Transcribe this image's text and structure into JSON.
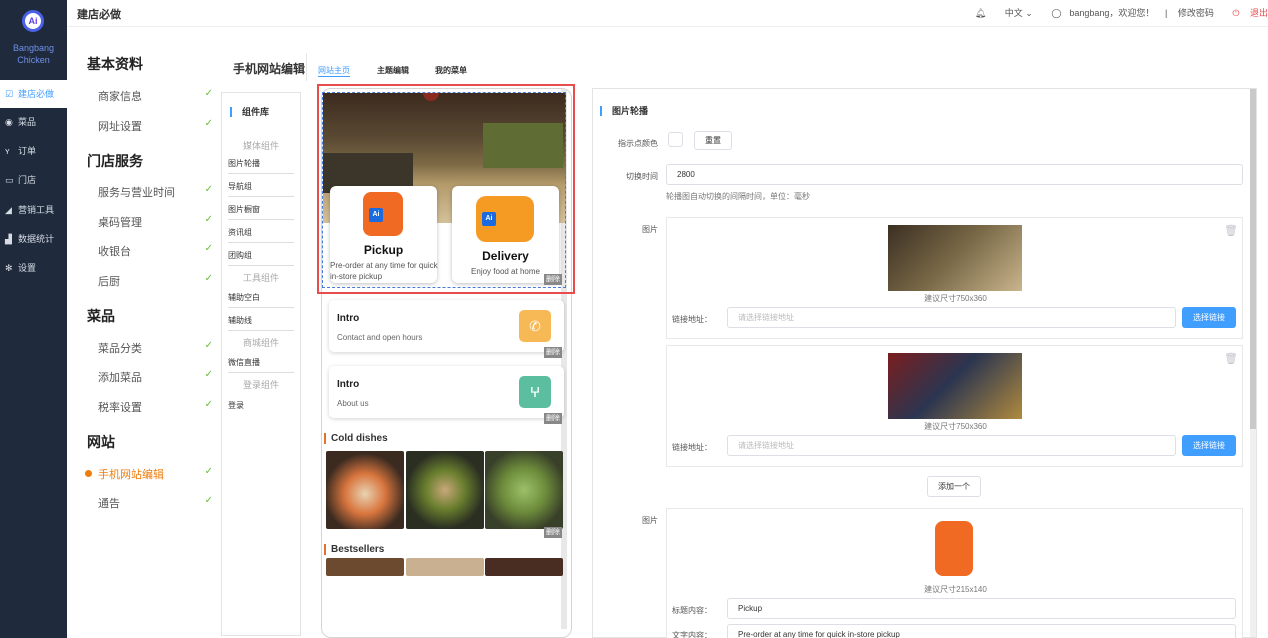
{
  "app": {
    "logo_text": "Ai",
    "brand_line1": "Bangbang",
    "brand_line2": "Chicken",
    "breadcrumb": "建店必做"
  },
  "left_nav": [
    {
      "label": "建店必做",
      "icon": "check-square-icon",
      "glyph": "☑",
      "active": true
    },
    {
      "label": "菜品",
      "icon": "dish-icon",
      "glyph": "◉",
      "active": false
    },
    {
      "label": "订单",
      "icon": "cutlery-icon",
      "glyph": "ʏ",
      "active": false
    },
    {
      "label": "门店",
      "icon": "store-icon",
      "glyph": "▭",
      "active": false
    },
    {
      "label": "营销工具",
      "icon": "megaphone-icon",
      "glyph": "◢",
      "active": false
    },
    {
      "label": "数据统计",
      "icon": "chart-icon",
      "glyph": "▟",
      "active": false
    },
    {
      "label": "设置",
      "icon": "gear-icon",
      "glyph": "✻",
      "active": false
    }
  ],
  "topbar": {
    "language": "中文",
    "user_greeting": "bangbang，欢迎您！",
    "change_password": "修改密码",
    "logout": "退出"
  },
  "secondary_menu": {
    "groups": [
      {
        "title": "基本资料",
        "items": [
          "商家信息",
          "网址设置"
        ]
      },
      {
        "title": "门店服务",
        "items": [
          "服务与营业时间",
          "桌码管理",
          "收银台",
          "后厨"
        ]
      },
      {
        "title": "菜品",
        "items": [
          "菜品分类",
          "添加菜品",
          "税率设置"
        ]
      },
      {
        "title": "网站",
        "items": [
          "手机网站编辑",
          "通告"
        ]
      }
    ],
    "active_item": "手机网站编辑",
    "check_mark": "✓"
  },
  "editor": {
    "title": "手机网站编辑",
    "tabs": [
      {
        "label": "网站主页",
        "active": true
      },
      {
        "label": "主题编辑",
        "active": false
      },
      {
        "label": "我的菜单",
        "active": false
      }
    ]
  },
  "component_library": {
    "title": "组件库",
    "groups": [
      {
        "title": "媒体组件",
        "items": [
          "图片轮播",
          "导航组",
          "图片橱窗",
          "资讯组",
          "团购组"
        ]
      },
      {
        "title": "工具组件",
        "items": [
          "辅助空白",
          "辅助线"
        ]
      },
      {
        "title": "商城组件",
        "items": [
          "微信直播"
        ]
      },
      {
        "title": "登录组件",
        "items": [
          "登录"
        ]
      }
    ]
  },
  "phone_preview": {
    "pickup": {
      "title": "Pickup",
      "subtitle": "Pre-order at any time for quick in-store pickup"
    },
    "delivery": {
      "title": "Delivery",
      "subtitle": "Enjoy food at home"
    },
    "intro_cards": [
      {
        "title": "Intro",
        "subtitle": "Contact and open hours",
        "icon": "phone-icon",
        "glyph": "✆",
        "color": "#f7b955"
      },
      {
        "title": "Intro",
        "subtitle": "About us",
        "icon": "fork-knife-icon",
        "glyph": "ⵖ",
        "color": "#5bbf9f"
      }
    ],
    "delete_label": "删除",
    "sections": [
      "Cold dishes",
      "Bestsellers"
    ]
  },
  "settings_panel": {
    "title": "图片轮播",
    "dot_color_label": "指示点颜色",
    "reset_button": "重置",
    "interval_label": "切换时间",
    "interval_value": "2800",
    "interval_hint": "轮播图自动切换的间隔时间，单位：毫秒",
    "images_label": "图片",
    "images": [
      {
        "size_hint": "建议尺寸750x360",
        "link_label": "链接地址：",
        "link_placeholder": "请选择链接地址",
        "choose_button": "选择链接"
      },
      {
        "size_hint": "建议尺寸750x360",
        "link_label": "链接地址：",
        "link_placeholder": "请选择链接地址",
        "choose_button": "选择链接"
      }
    ],
    "add_button": "添加一个",
    "images2_label": "图片",
    "image2_size_hint": "建议尺寸215x140",
    "title_content_label": "标题内容：",
    "title_content_value": "Pickup",
    "desc_label": "文字内容：",
    "desc_value": "Pre-order at any time for quick in-store pickup"
  }
}
